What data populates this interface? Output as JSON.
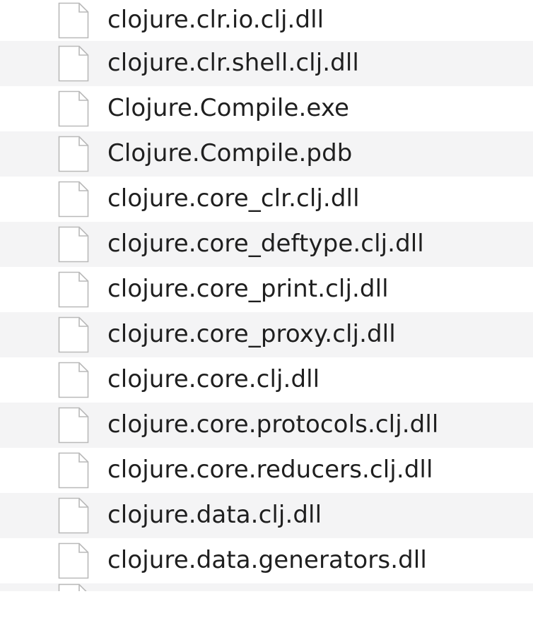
{
  "file_list": {
    "files": [
      {
        "name": "clojure.clr.io.clj.dll",
        "icon": "document-icon"
      },
      {
        "name": "clojure.clr.shell.clj.dll",
        "icon": "document-icon"
      },
      {
        "name": "Clojure.Compile.exe",
        "icon": "document-icon"
      },
      {
        "name": "Clojure.Compile.pdb",
        "icon": "document-icon"
      },
      {
        "name": "clojure.core_clr.clj.dll",
        "icon": "document-icon"
      },
      {
        "name": "clojure.core_deftype.clj.dll",
        "icon": "document-icon"
      },
      {
        "name": "clojure.core_print.clj.dll",
        "icon": "document-icon"
      },
      {
        "name": "clojure.core_proxy.clj.dll",
        "icon": "document-icon"
      },
      {
        "name": "clojure.core.clj.dll",
        "icon": "document-icon"
      },
      {
        "name": "clojure.core.protocols.clj.dll",
        "icon": "document-icon"
      },
      {
        "name": "clojure.core.reducers.clj.dll",
        "icon": "document-icon"
      },
      {
        "name": "clojure.data.clj.dll",
        "icon": "document-icon"
      },
      {
        "name": "clojure.data.generators.dll",
        "icon": "document-icon"
      }
    ],
    "colors": {
      "row_alt_background": "#f4f4f5",
      "text": "#1f1f1f",
      "icon_stroke": "#b9b9b9"
    }
  }
}
